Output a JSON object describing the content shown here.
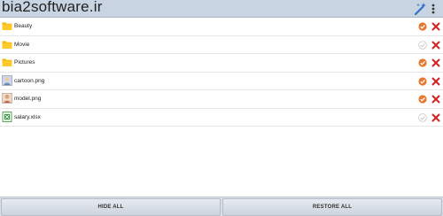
{
  "action_bar": {
    "watermark": "bia2software.ir",
    "wand_icon": "magic-wand-icon",
    "overflow_icon": "overflow-menu-icon"
  },
  "files": [
    {
      "name": "Beauty",
      "icon": "folder-icon",
      "hidden": true
    },
    {
      "name": "Movie",
      "icon": "folder-icon",
      "hidden": false
    },
    {
      "name": "Pictures",
      "icon": "folder-icon",
      "hidden": true
    },
    {
      "name": "cartoon.png",
      "icon": "image-file-icon",
      "hidden": true
    },
    {
      "name": "model.png",
      "icon": "image-file-icon",
      "hidden": true
    },
    {
      "name": "salary.xlsx",
      "icon": "spreadsheet-file-icon",
      "hidden": false
    }
  ],
  "bottom_bar": {
    "hide_all_label": "HIDE ALL",
    "restore_all_label": "RESTORE ALL"
  },
  "colors": {
    "action_bar": "#c9d4e3",
    "check_on": "#e8772e",
    "check_off": "#c8c8c8",
    "delete": "#d32020",
    "folder": "#f4b400"
  }
}
